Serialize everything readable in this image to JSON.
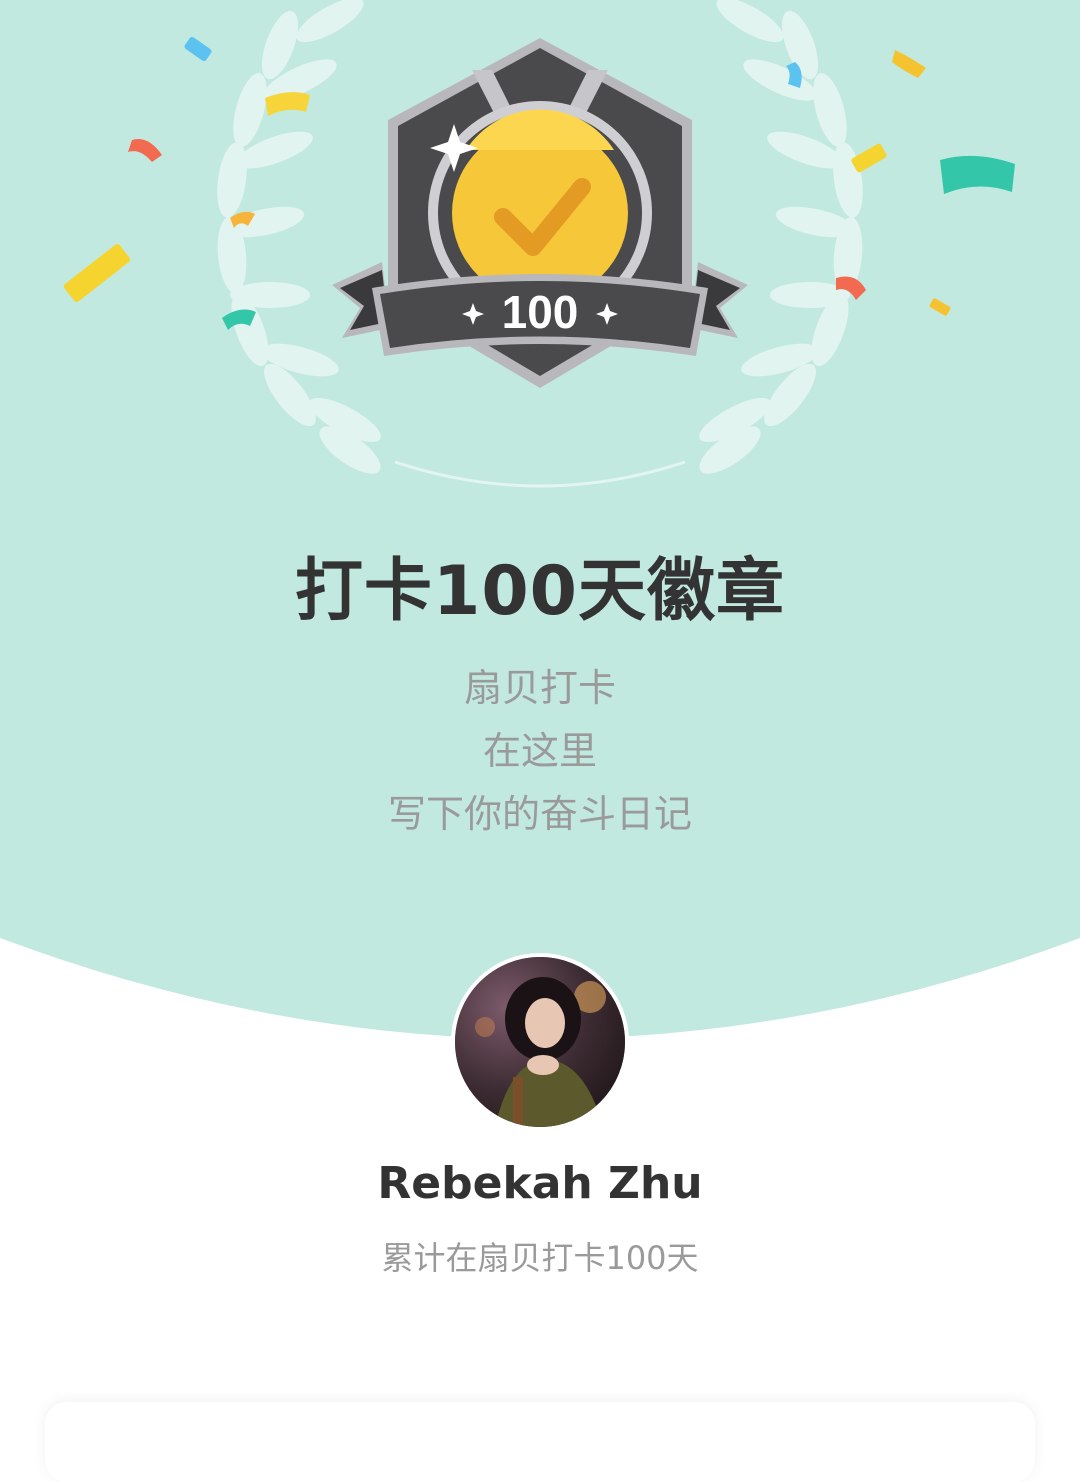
{
  "badge": {
    "count_label": "100",
    "title": "打卡100天徽章"
  },
  "slogan": {
    "lines": [
      "扇贝打卡",
      "在这里",
      "写下你的奋斗日记"
    ]
  },
  "user": {
    "name": "Rebekah Zhu",
    "stat": "累计在扇贝打卡100天"
  },
  "colors": {
    "hero_bg": "#c2e9e0",
    "badge_dark": "#4a4a4c",
    "badge_gold": "#f6c738",
    "text_dark": "#333333",
    "text_gray": "#9a9a9a"
  }
}
